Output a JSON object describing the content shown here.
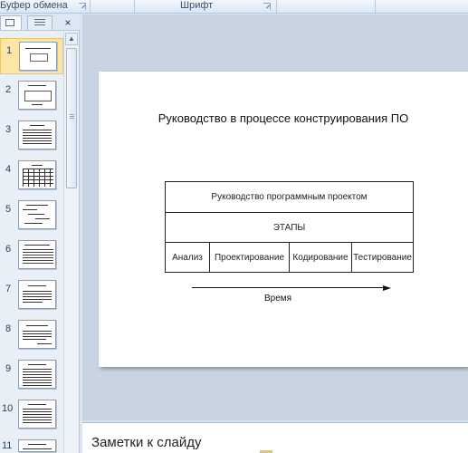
{
  "ribbon": {
    "clipboard_label": "Буфер обмена",
    "font_label": "Шрифт"
  },
  "panel": {
    "close_glyph": "×",
    "slides": [
      {
        "number": "1",
        "selected": true
      },
      {
        "number": "2"
      },
      {
        "number": "3"
      },
      {
        "number": "4"
      },
      {
        "number": "5"
      },
      {
        "number": "6"
      },
      {
        "number": "7"
      },
      {
        "number": "8"
      },
      {
        "number": "9"
      },
      {
        "number": "10"
      },
      {
        "number": "11"
      }
    ]
  },
  "slide": {
    "title": "Руководство в процессе конструирования ПО",
    "diagram": {
      "top_row": "Руководство программным проектом",
      "middle_row": "ЭТАПЫ",
      "stages": [
        "Анализ",
        "Проектирование",
        "Кодирование",
        "Тестирование"
      ]
    },
    "axis_label": "Время"
  },
  "notes": {
    "placeholder": "Заметки к слайду"
  }
}
